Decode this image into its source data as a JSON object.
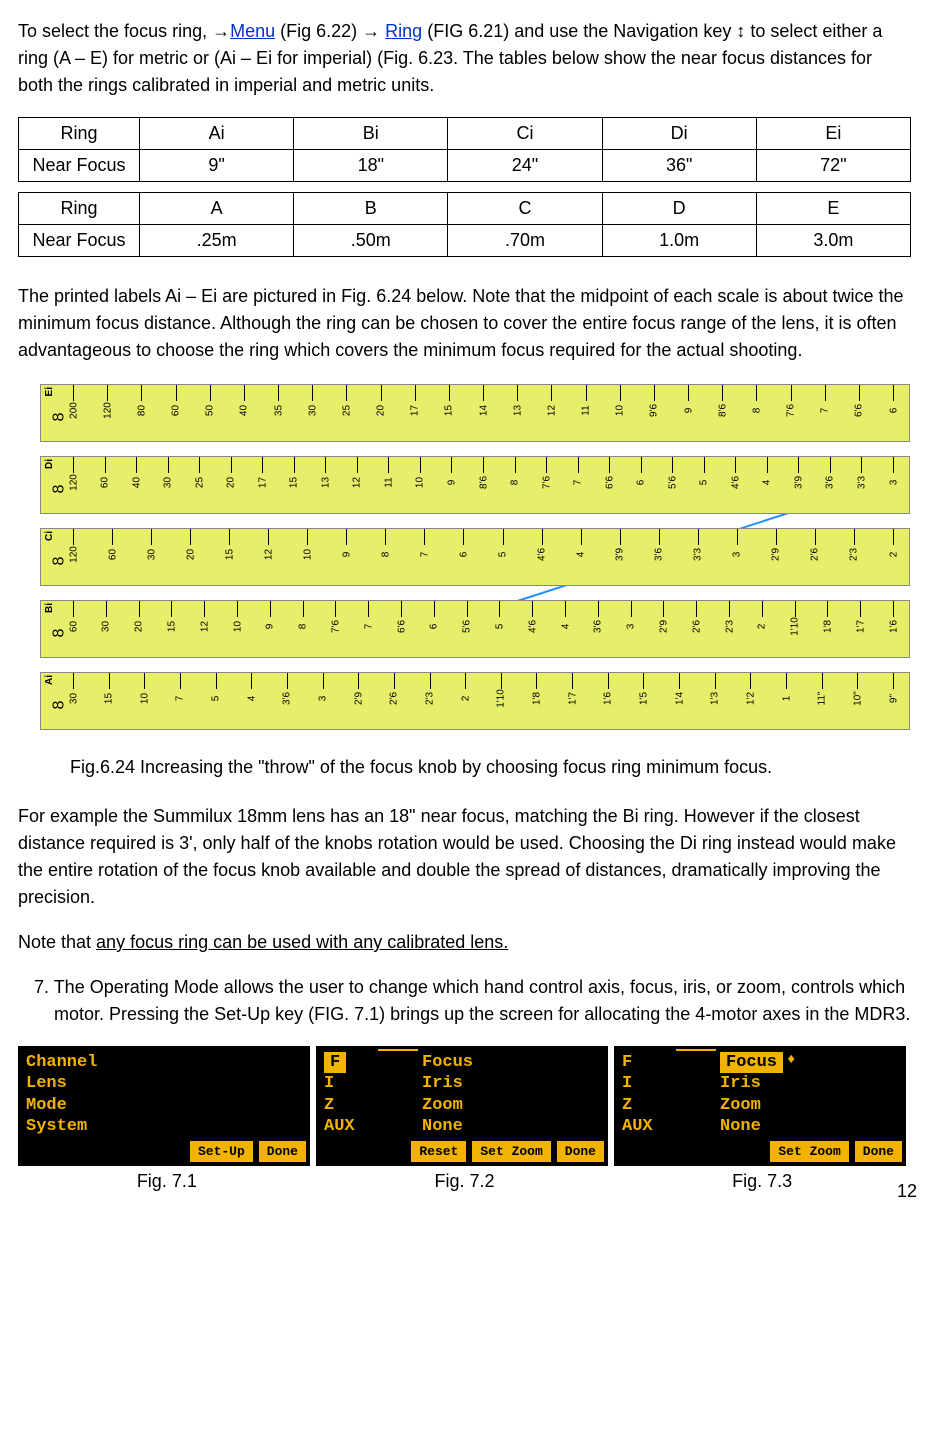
{
  "intro": {
    "pre_menu": "To select the focus ring, →",
    "menu": "Menu",
    "mid1": " (Fig 6.22) → ",
    "ring": "Ring",
    "post_ring": " (FIG 6.21) and use the Navigation key ↕ to select either a ring (A – E) for metric or (Ai – Ei for imperial) (Fig. 6.23. The tables below show the near focus distances for both the rings calibrated in imperial and metric units."
  },
  "table_imperial": {
    "r1": [
      "Ring",
      "Ai",
      "Bi",
      "Ci",
      "Di",
      "Ei"
    ],
    "r2": [
      "Near Focus",
      "9\"",
      "18\"",
      "24\"",
      "36\"",
      "72\""
    ]
  },
  "table_metric": {
    "r1": [
      "Ring",
      "A",
      "B",
      "C",
      "D",
      "E"
    ],
    "r2": [
      "Near Focus",
      ".25m",
      ".50m",
      ".70m",
      "1.0m",
      "3.0m"
    ]
  },
  "para2": "The printed labels Ai – Ei are pictured in Fig. 6.24 below. Note that the midpoint of each scale is about twice the minimum focus distance. Although the ring can be chosen to cover the entire focus range of the lens, it is often advantageous to choose the ring which covers the minimum focus required for the actual shooting.",
  "fig624": {
    "caption": "Fig.6.24 Increasing the \"throw\" of the focus knob by choosing focus ring minimum focus.",
    "scales": [
      "Ei",
      "Di",
      "Ci",
      "Bi",
      "Ai"
    ],
    "ticks": {
      "Ei": [
        "200",
        "120",
        "80",
        "60",
        "50",
        "40",
        "35",
        "30",
        "25",
        "20",
        "17",
        "15",
        "14",
        "13",
        "12",
        "11",
        "10",
        "9'6",
        "9",
        "8'6",
        "8",
        "7'6",
        "7",
        "6'6",
        "6"
      ],
      "Di": [
        "120",
        "60",
        "40",
        "30",
        "25",
        "20",
        "17",
        "15",
        "13",
        "12",
        "11",
        "10",
        "9",
        "8'6",
        "8",
        "7'6",
        "7",
        "6'6",
        "6",
        "5'6",
        "5",
        "4'6",
        "4",
        "3'9",
        "3'6",
        "3'3",
        "3"
      ],
      "Ci": [
        "120",
        "60",
        "30",
        "20",
        "15",
        "12",
        "10",
        "9",
        "8",
        "7",
        "6",
        "5",
        "4'6",
        "4",
        "3'9",
        "3'6",
        "3'3",
        "3",
        "2'9",
        "2'6",
        "2'3",
        "2"
      ],
      "Bi": [
        "60",
        "30",
        "20",
        "15",
        "12",
        "10",
        "9",
        "8",
        "7'6",
        "7",
        "6'6",
        "6",
        "5'6",
        "5",
        "4'6",
        "4",
        "3'6",
        "3",
        "2'9",
        "2'6",
        "2'3",
        "2",
        "1'10",
        "1'8",
        "1'7",
        "1'6"
      ],
      "Ai": [
        "30",
        "15",
        "10",
        "7",
        "5",
        "4",
        "3'6",
        "3",
        "2'9",
        "2'6",
        "2'3",
        "2",
        "1'10",
        "1'8",
        "1'7",
        "1'6",
        "1'5",
        "1'4",
        "1'3",
        "1'2",
        "1",
        "11\"",
        "10\"",
        "9\""
      ]
    }
  },
  "para3": "For example the Summilux 18mm lens has an 18\" near focus, matching the Bi ring. However if the closest distance required is 3', only half of the knobs rotation would be used.  Choosing the Di ring instead would make the entire rotation of the focus knob available and double the spread of distances, dramatically improving the precision.",
  "para4_pre": "Note that ",
  "para4_underline": "any focus ring can be used with any calibrated lens.",
  "para5": "7. The Operating Mode allows the user to change which hand control axis, focus, iris, or zoom, controls which motor. Pressing the Set-Up key (FIG. 7.1) brings up the screen for allocating the 4-motor axes in the MDR3.",
  "screen1": {
    "lines": [
      "Channel",
      "Lens",
      "Mode",
      "System"
    ],
    "buttons": [
      "Set-Up",
      "Done"
    ]
  },
  "screen2": {
    "rows": [
      {
        "k": "F",
        "v": "Focus",
        "sel_k": true
      },
      {
        "k": "I",
        "v": "Iris"
      },
      {
        "k": "Z",
        "v": "Zoom"
      },
      {
        "k": "AUX",
        "v": "None"
      }
    ],
    "buttons": [
      "Reset",
      "Set Zoom",
      "Done"
    ]
  },
  "screen3": {
    "rows": [
      {
        "k": "F",
        "v": "Focus",
        "sel_v": true,
        "arrow": true
      },
      {
        "k": "I",
        "v": "Iris"
      },
      {
        "k": "Z",
        "v": "Zoom"
      },
      {
        "k": "AUX",
        "v": "None"
      }
    ],
    "buttons": [
      "Set Zoom",
      "Done"
    ]
  },
  "captions": {
    "c1": "Fig. 7.1",
    "c2": "Fig. 7.2",
    "c3": "Fig. 7.3"
  },
  "page_number": "12"
}
